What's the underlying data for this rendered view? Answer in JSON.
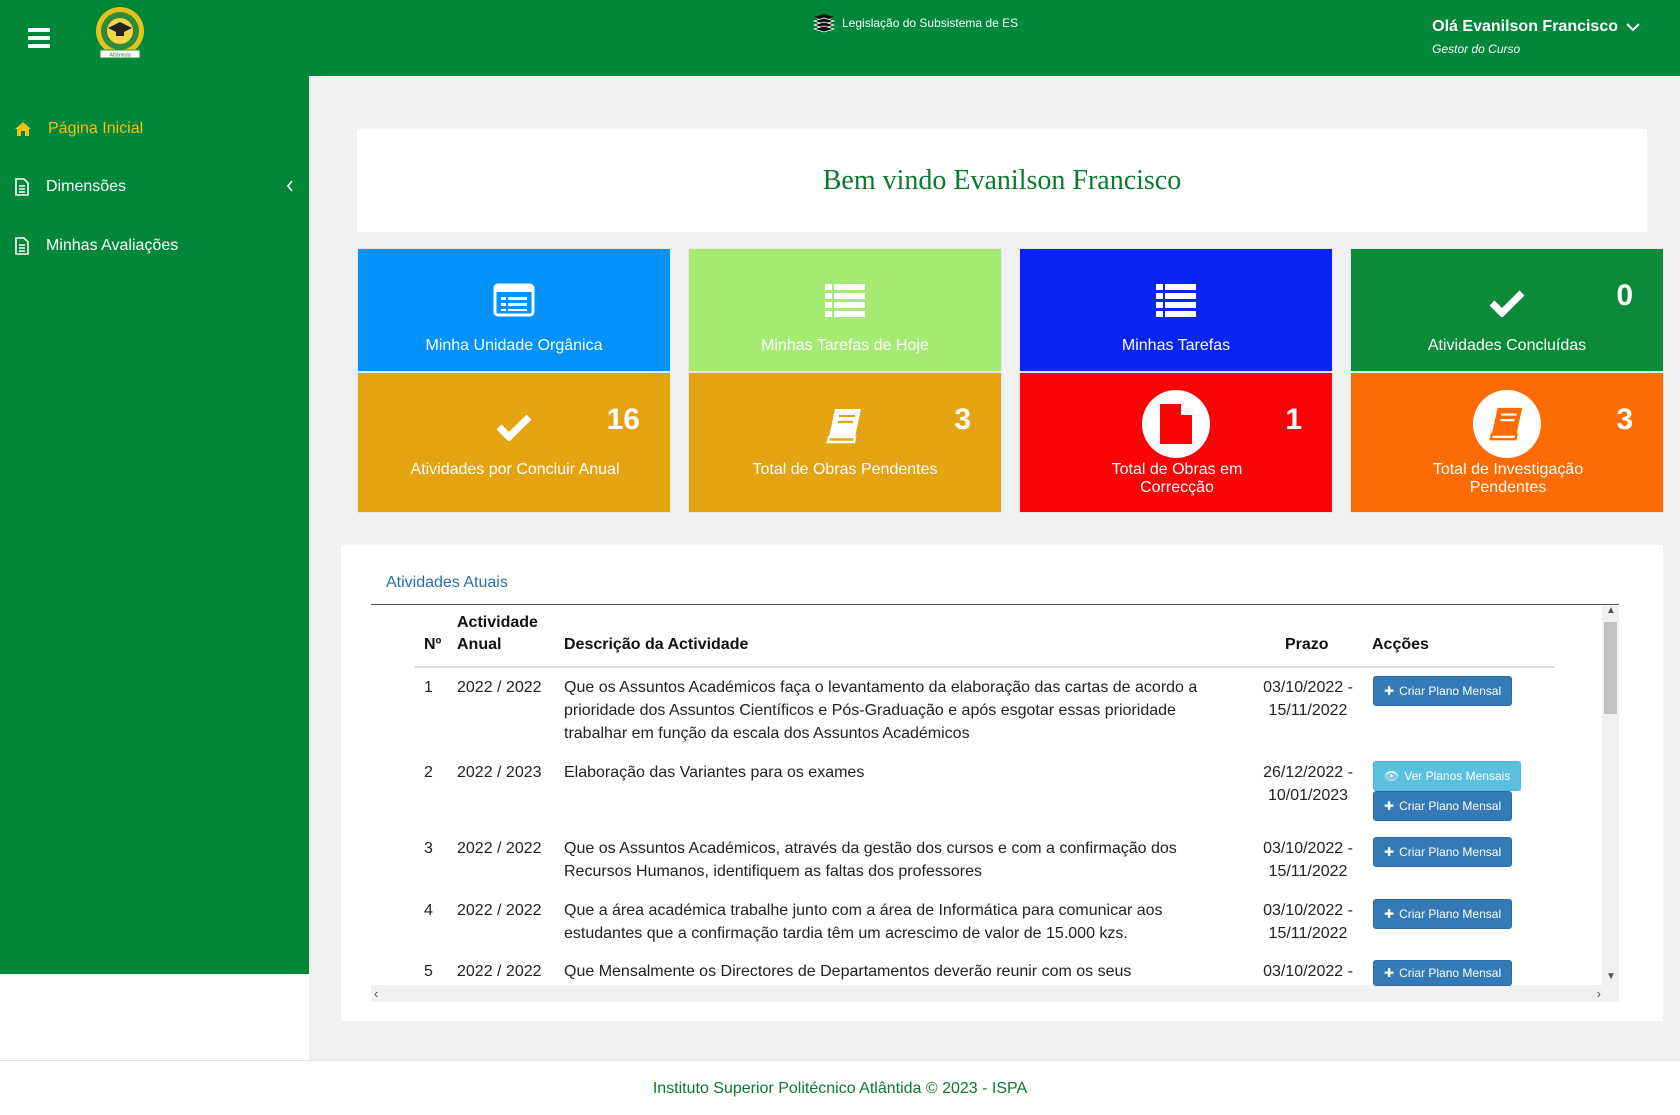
{
  "header": {
    "legislation_link": "Legislação do Subsistema de ES",
    "user_greeting": "Olá Evanilson Francisco",
    "user_role": "Gestor do Curso",
    "logo_text": "Atlântida"
  },
  "sidebar": {
    "items": [
      {
        "label": "Página Inicial",
        "icon": "home-icon",
        "active": true
      },
      {
        "label": "Dimensões",
        "icon": "file-icon",
        "active": false
      },
      {
        "label": "Minhas Avaliações",
        "icon": "file-icon",
        "active": false
      }
    ]
  },
  "welcome": {
    "title": "Bem vindo Evanilson Francisco"
  },
  "tiles": [
    {
      "label": "Minha Unidade Orgânica",
      "count": "",
      "color": "#0292fa",
      "icon": "id-card-icon"
    },
    {
      "label": "Minhas Tarefas de Hoje",
      "count": "",
      "color": "#a5ea72",
      "icon": "list-icon"
    },
    {
      "label": "Minhas Tarefas",
      "count": "",
      "color": "#0a24f5",
      "icon": "list-icon"
    },
    {
      "label": "Atividades Concluídas",
      "count": "0",
      "color": "#0b8a3a",
      "icon": "check-icon"
    },
    {
      "label": "Atividades por Concluir Anual",
      "count": "16",
      "color": "#e4a412",
      "icon": "check-icon"
    },
    {
      "label": "Total de Obras Pendentes",
      "count": "3",
      "color": "#e4a412",
      "icon": "book-icon"
    },
    {
      "label": "Total de Obras em Correcção",
      "count": "1",
      "color": "#fa0407",
      "icon": "document-icon"
    },
    {
      "label": "Total de Investigação Pendentes",
      "count": "3",
      "color": "#fd6c02",
      "icon": "book-icon"
    }
  ],
  "activities": {
    "title": "Atividades Atuais",
    "columns": {
      "num": "Nº",
      "annual": "Actividade Anual",
      "desc": "Descrição da Actividade",
      "deadline": "Prazo",
      "actions": "Acções"
    },
    "rows": [
      {
        "num": "1",
        "annual": "2022 / 2022",
        "desc": "Que os Assuntos Académicos faça o levantamento da elaboração das cartas de acordo a prioridade dos Assuntos Científicos e Pós-Graduação e após esgotar essas prioridade trabalhar em função da escala dos Assuntos Académicos",
        "deadline": "03/10/2022 - 15/11/2022"
      },
      {
        "num": "2",
        "annual": "2022 / 2023",
        "desc": "Elaboração das Variantes para os exames",
        "deadline": "26/12/2022 - 10/01/2023"
      },
      {
        "num": "3",
        "annual": "2022 / 2022",
        "desc": "Que os Assuntos Académicos, através da gestão dos cursos e com a confirmação dos Recursos Humanos, identifiquem as faltas dos professores",
        "deadline": "03/10/2022 - 15/11/2022"
      },
      {
        "num": "4",
        "annual": "2022 / 2022",
        "desc": "Que a área académica trabalhe junto com a área de Informática para comunicar aos estudantes que a confirmação tardia têm um acrescimo de valor de 15.000 kzs.",
        "deadline": "03/10/2022 - 15/11/2022"
      },
      {
        "num": "5",
        "annual": "2022 / 2022",
        "desc": "Que Mensalmente os Directores de Departamentos deverão reunir com os seus",
        "deadline": "03/10/2022 -"
      }
    ],
    "btn_create": "Criar Plano Mensal",
    "btn_view": "Ver Planos Mensais"
  },
  "footer": {
    "text": "Instituto Superior Politécnico Atlântida © 2023 - ISPA"
  }
}
